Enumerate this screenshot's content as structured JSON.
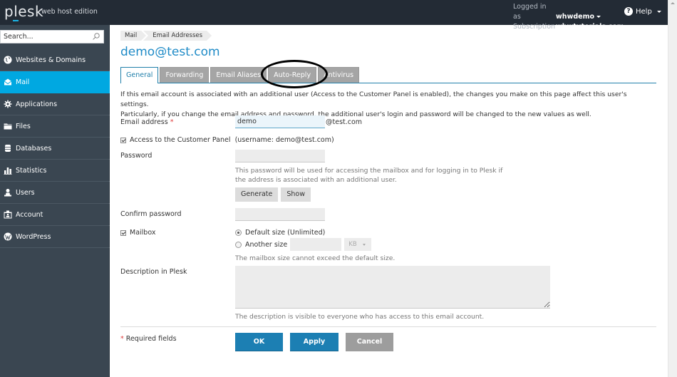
{
  "header": {
    "logo": "plesk",
    "edition": "web host edition",
    "logged_in_label": "Logged in as",
    "logged_in_user": "whwdemo",
    "subscription_label": "Subscription",
    "subscription_value": "whwtutorials.com",
    "help_label": "Help",
    "accent_color": "#1ab4e6"
  },
  "sidebar": {
    "search_placeholder": "Search...",
    "items": [
      {
        "label": "Websites & Domains",
        "icon": "globe-icon",
        "active": false
      },
      {
        "label": "Mail",
        "icon": "mail-icon",
        "active": true
      },
      {
        "label": "Applications",
        "icon": "gear-icon",
        "active": false
      },
      {
        "label": "Files",
        "icon": "folder-icon",
        "active": false
      },
      {
        "label": "Databases",
        "icon": "database-icon",
        "active": false
      },
      {
        "label": "Statistics",
        "icon": "bar-chart-icon",
        "active": false
      },
      {
        "label": "Users",
        "icon": "user-icon",
        "active": false
      },
      {
        "label": "Account",
        "icon": "account-icon",
        "active": false
      },
      {
        "label": "WordPress",
        "icon": "wordpress-icon",
        "active": false
      }
    ],
    "active_color": "#00a8e1"
  },
  "main": {
    "breadcrumb": [
      "Mail",
      "Email Addresses"
    ],
    "title": "demo@test.com",
    "tabs": [
      {
        "label": "General",
        "active": true
      },
      {
        "label": "Forwarding",
        "active": false
      },
      {
        "label": "Email Aliases",
        "active": false
      },
      {
        "label": "Auto-Reply",
        "active": false,
        "annotated": true
      },
      {
        "label": "Antivirus",
        "active": false
      }
    ],
    "intro_line1": "If this email account is associated with an additional user (Access to the Customer Panel is enabled), the changes you make on this page affect this user's settings.",
    "intro_line2": "Particularly, if you change the email address and password, the additional user's login and password will be changed to the new values as well.",
    "form": {
      "email_label": "Email address",
      "required_mark": "*",
      "email_value": "demo",
      "email_suffix": "@test.com",
      "customer_panel_label": "Access to the Customer Panel",
      "customer_panel_checked": true,
      "customer_panel_username": "(username: demo@test.com)",
      "password_label": "Password",
      "password_value": "",
      "password_hint_line1": "This password will be used for accessing the mailbox and for logging in to Plesk if",
      "password_hint_line2": "the address is associated with an additional user.",
      "generate_label": "Generate",
      "show_label": "Show",
      "confirm_password_label": "Confirm password",
      "confirm_password_value": "",
      "mailbox_label": "Mailbox",
      "mailbox_checked": true,
      "mailbox_default_option": "Default size (Unlimited)",
      "mailbox_default_selected": true,
      "mailbox_other_option": "Another size",
      "mailbox_other_value": "",
      "mailbox_unit": "KB",
      "mailbox_hint": "The mailbox size cannot exceed the default size.",
      "description_label": "Description in Plesk",
      "description_value": "",
      "description_hint": "The description is visible to everyone who has access to this email account.",
      "required_fields_note": "Required fields",
      "ok_label": "OK",
      "apply_label": "Apply",
      "cancel_label": "Cancel"
    },
    "title_color": "#1f8bc7",
    "primary_button_color": "#1c7fb3"
  }
}
